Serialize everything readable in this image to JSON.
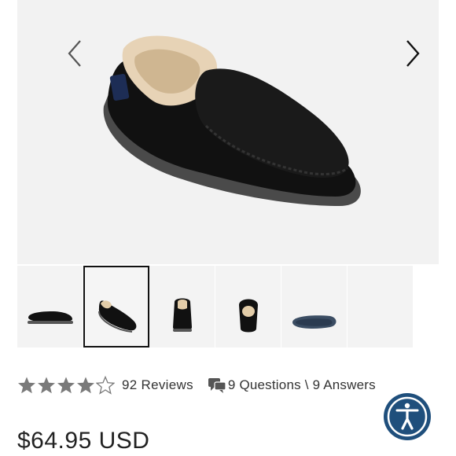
{
  "product": {
    "image_alt": "Black suede moccasin slipper with sheepskin lining",
    "thumbnails": [
      {
        "view": "side",
        "selected": false
      },
      {
        "view": "angled",
        "selected": true
      },
      {
        "view": "back",
        "selected": false
      },
      {
        "view": "front",
        "selected": false
      },
      {
        "view": "sole",
        "selected": false
      },
      {
        "view": "empty",
        "selected": false
      }
    ]
  },
  "rating": {
    "value": 4,
    "max": 5,
    "reviews_label": "92 Reviews"
  },
  "qa": {
    "label": "9 Questions \\ 9 Answers"
  },
  "price": {
    "label": "$64.95 USD"
  },
  "icons": {
    "prev": "chevron-left-icon",
    "next": "chevron-right-icon",
    "star": "star-icon",
    "qa": "chat-bubbles-icon",
    "accessibility": "accessibility-icon"
  },
  "colors": {
    "star_filled": "#7a7a7a",
    "accessibility_ring": "#1f4f7c",
    "thumb_selected_border": "#111111"
  }
}
